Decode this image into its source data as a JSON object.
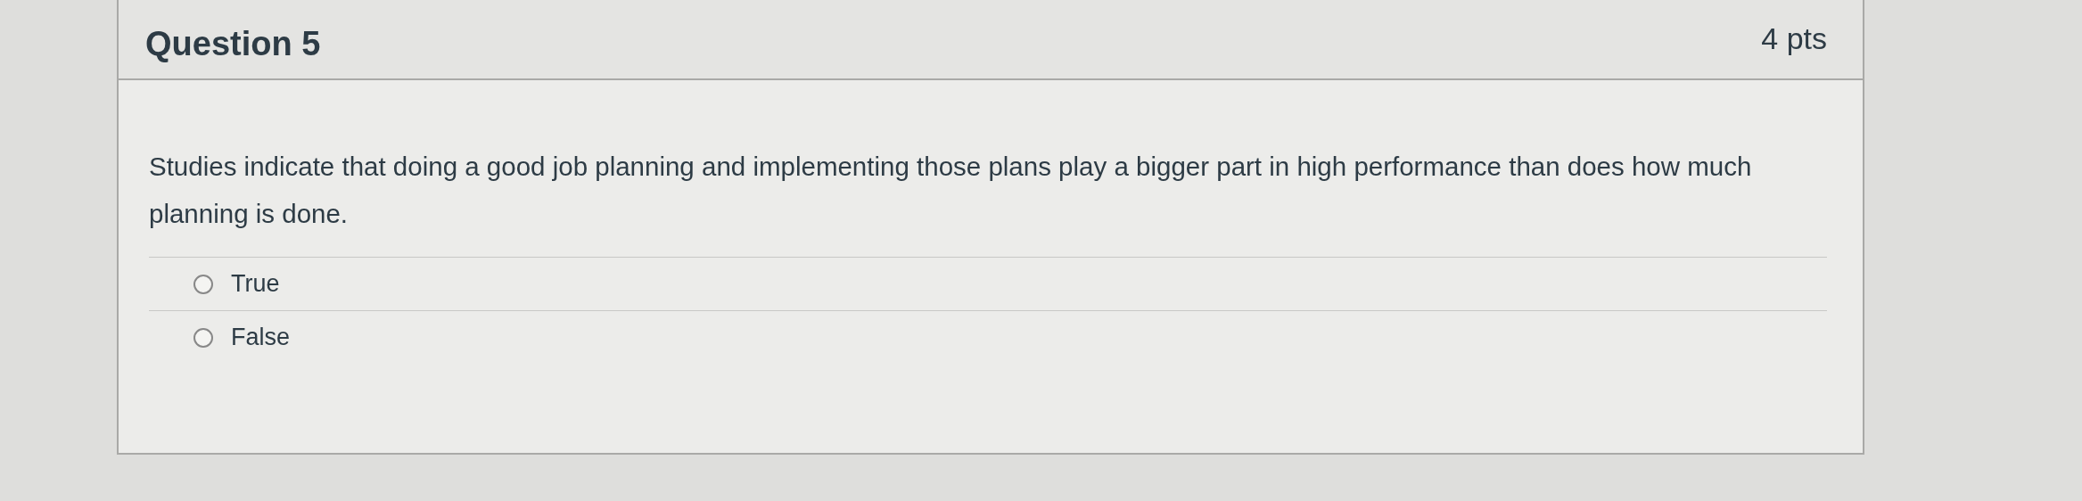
{
  "question": {
    "title": "Question 5",
    "points": "4 pts"
  },
  "question_text": "Studies indicate that doing a good job planning and implementing those plans play a bigger part in high performance than does how much planning is done.",
  "answers": [
    {
      "label": "True",
      "selected": false
    },
    {
      "label": "False",
      "selected": false
    }
  ]
}
